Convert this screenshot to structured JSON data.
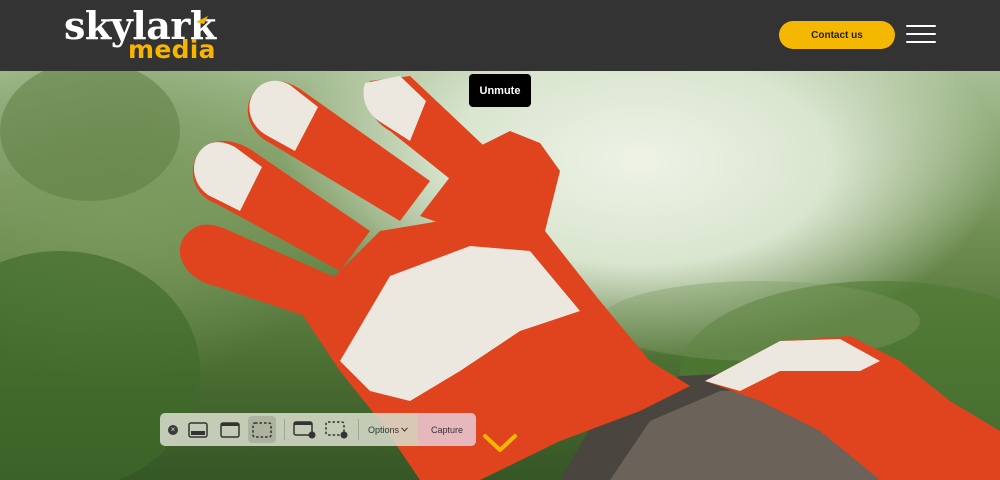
{
  "header": {
    "logo": {
      "line1": "skylark",
      "line2": "media"
    },
    "contact_label": "Contact us",
    "menu_icon": "hamburger-icon"
  },
  "hero": {
    "unmute_label": "Unmute"
  },
  "toolbar": {
    "options_label": "Options",
    "capture_label": "Capture",
    "icons": [
      "close-icon",
      "capture-window-icon",
      "capture-screen-icon",
      "capture-selection-icon",
      "record-screen-icon",
      "record-selection-icon",
      "chevron-down-icon"
    ]
  },
  "colors": {
    "header_bg": "#333333",
    "accent": "#f5b800",
    "glove_red": "#e0441f",
    "glove_white": "#ece8e0"
  }
}
